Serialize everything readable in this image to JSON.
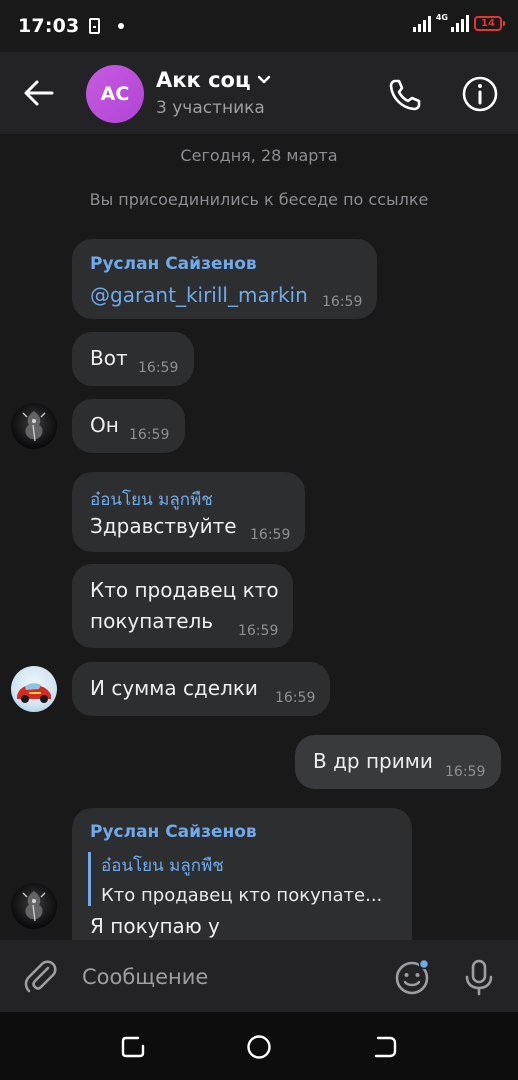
{
  "status_bar": {
    "time": "17:03",
    "network": "4G",
    "battery": "14"
  },
  "header": {
    "avatar_initials": "AC",
    "title": "Акк соц",
    "subtitle": "3 участника"
  },
  "messages": {
    "date_separator": "Сегодня, 28 марта",
    "system_notice": "Вы присоединились к беседе по ссылке",
    "items": [
      {
        "author": "Руслан Сайзенов",
        "link": "@garant_kirill_markin",
        "time": "16:59"
      },
      {
        "text": "Вот",
        "time": "16:59"
      },
      {
        "text": "Он",
        "time": "16:59"
      },
      {
        "author": "อ๋อนโยน มลูกพืช",
        "text": "Здравствуйте",
        "time": "16:59"
      },
      {
        "text_line1": "Кто продавец кто",
        "text_line2": "покупатель",
        "time": "16:59"
      },
      {
        "text": "И сумма сделки",
        "time": "16:59"
      },
      {
        "text": "В др прими",
        "time": "16:59"
      },
      {
        "author": "Руслан Сайзенов",
        "reply_author": "อ๋อนโยน มลูกพืช",
        "reply_text": "Кто продавец кто покупате...",
        "text": "Я покупаю у"
      }
    ]
  },
  "composer": {
    "placeholder": "Сообщение"
  },
  "colors": {
    "background": "#19191a",
    "header_bg": "#232325",
    "bubble_in": "#2d2e30",
    "bubble_out": "#383a3d",
    "accent_blue": "#71aaeb",
    "avatar_purple": "#b94fdb",
    "battery_red": "#e8332e"
  },
  "icons": {
    "back": "arrow-left-icon",
    "call": "phone-icon",
    "info": "info-icon",
    "attach": "paperclip-icon",
    "sticker": "smiley-icon",
    "mic": "microphone-icon"
  }
}
